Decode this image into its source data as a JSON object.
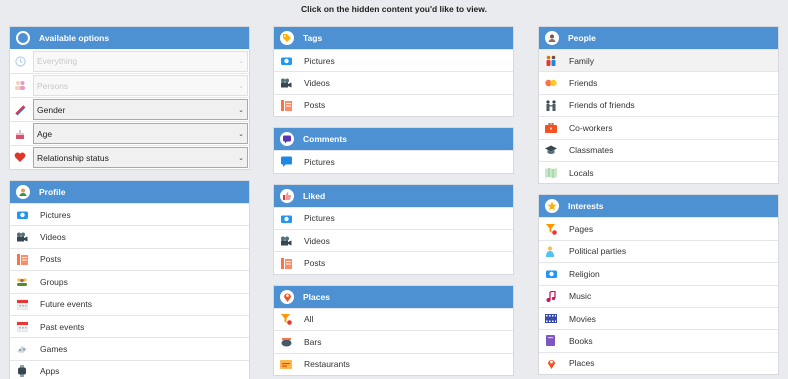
{
  "hint": "Click on the hidden content you'd like to view.",
  "options": {
    "title": "Available options",
    "selects": [
      {
        "value": "Everything",
        "icon": "clock-icon",
        "disabled": true
      },
      {
        "value": "Persons",
        "icon": "persons-icon",
        "disabled": true
      },
      {
        "value": "Gender",
        "icon": "gender-icon",
        "disabled": false
      },
      {
        "value": "Age",
        "icon": "cake-icon",
        "disabled": false
      },
      {
        "value": "Relationship status",
        "icon": "heart-icon",
        "disabled": false
      }
    ]
  },
  "profile": {
    "title": "Profile",
    "items": [
      "Pictures",
      "Videos",
      "Posts",
      "Groups",
      "Future events",
      "Past events",
      "Games",
      "Apps"
    ]
  },
  "tags": {
    "title": "Tags",
    "items": [
      "Pictures",
      "Videos",
      "Posts"
    ]
  },
  "comments": {
    "title": "Comments",
    "items": [
      "Pictures"
    ]
  },
  "liked": {
    "title": "Liked",
    "items": [
      "Pictures",
      "Videos",
      "Posts"
    ]
  },
  "places": {
    "title": "Places",
    "items": [
      "All",
      "Bars",
      "Restaurants"
    ]
  },
  "people": {
    "title": "People",
    "items": [
      "Family",
      "Friends",
      "Friends of friends",
      "Co-workers",
      "Classmates",
      "Locals"
    ]
  },
  "interests": {
    "title": "Interests",
    "items": [
      "Pages",
      "Political parties",
      "Religion",
      "Music",
      "Movies",
      "Books",
      "Places"
    ]
  },
  "colors": {
    "header": "#4d91d3",
    "background": "#e9ebee"
  }
}
